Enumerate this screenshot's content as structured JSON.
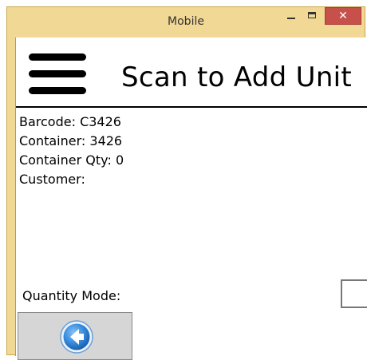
{
  "window": {
    "title": "Mobile",
    "minimize_icon": "minimize-icon",
    "maximize_icon": "maximize-icon",
    "close_glyph": "✕"
  },
  "header": {
    "menu_icon": "hamburger-menu-icon",
    "title": "Scan to Add Unit"
  },
  "info": {
    "barcode_label": "Barcode:",
    "barcode_value": "C3426",
    "container_label": "Container:",
    "container_value": "3426",
    "container_qty_label": "Container Qty:",
    "container_qty_value": "0",
    "customer_label": "Customer:",
    "customer_value": ""
  },
  "quantity_mode": {
    "label": "Quantity Mode:",
    "checked": false
  },
  "footer": {
    "back_icon": "back-arrow-icon"
  },
  "colors": {
    "window_frame": "#f1d894",
    "close_button": "#c7504b",
    "back_button_bg": "#d6d6d6",
    "back_icon_blue": "#2f7fd6"
  }
}
